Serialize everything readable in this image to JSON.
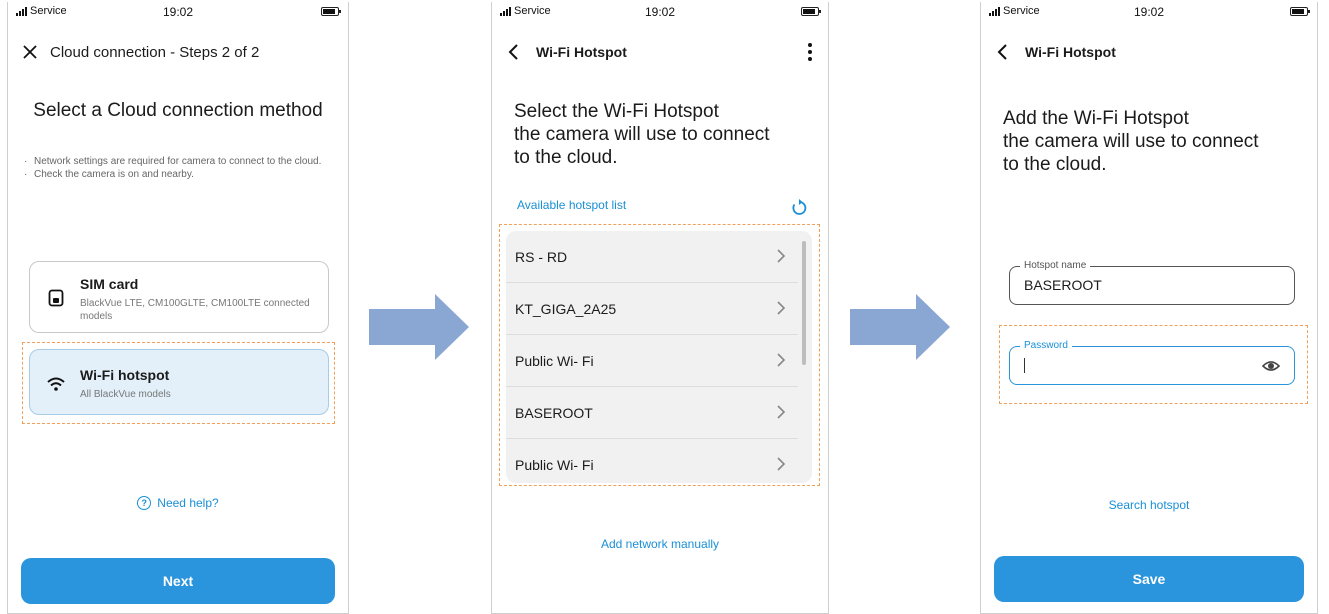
{
  "status": {
    "carrier": "Service",
    "time": "19:02"
  },
  "screen1": {
    "title": "Cloud connection - Steps 2 of 2",
    "heading": "Select a Cloud connection method",
    "notes": [
      "Network settings are required for camera to connect to the cloud.",
      "Check the camera is on and nearby."
    ],
    "methods": [
      {
        "title": "SIM card",
        "subtitle": "BlackVue LTE, CM100GLTE, CM100LTE connected models",
        "icon": "sim-card-icon",
        "selected": false
      },
      {
        "title": "Wi-Fi hotspot",
        "subtitle": "All BlackVue models",
        "icon": "wifi-icon",
        "selected": true
      }
    ],
    "help_label": "Need help?",
    "next_label": "Next"
  },
  "screen2": {
    "title": "Wi-Fi Hotspot",
    "heading_lines": [
      "Select the Wi-Fi Hotspot",
      "the camera will use to connect",
      "to the cloud."
    ],
    "list_title": "Available hotspot list",
    "hotspots": [
      "RS - RD",
      "KT_GIGA_2A25",
      "Public Wi- Fi",
      "BASEROOT",
      "Public Wi- Fi"
    ],
    "add_manual_label": "Add network manually"
  },
  "screen3": {
    "title": "Wi-Fi Hotspot",
    "heading_lines": [
      "Add the Wi-Fi Hotspot",
      "the camera will use to connect",
      "to the cloud."
    ],
    "hotspot_name_label": "Hotspot name",
    "hotspot_name_value": "BASEROOT",
    "password_label": "Password",
    "password_value": "",
    "search_label": "Search hotspot",
    "save_label": "Save"
  },
  "colors": {
    "accent": "#2a95dc",
    "link": "#1a8fd6",
    "highlight_dash": "#f0a05a",
    "flow_arrow": "#8aa6d2",
    "selected_card": "#e3f0f9"
  }
}
